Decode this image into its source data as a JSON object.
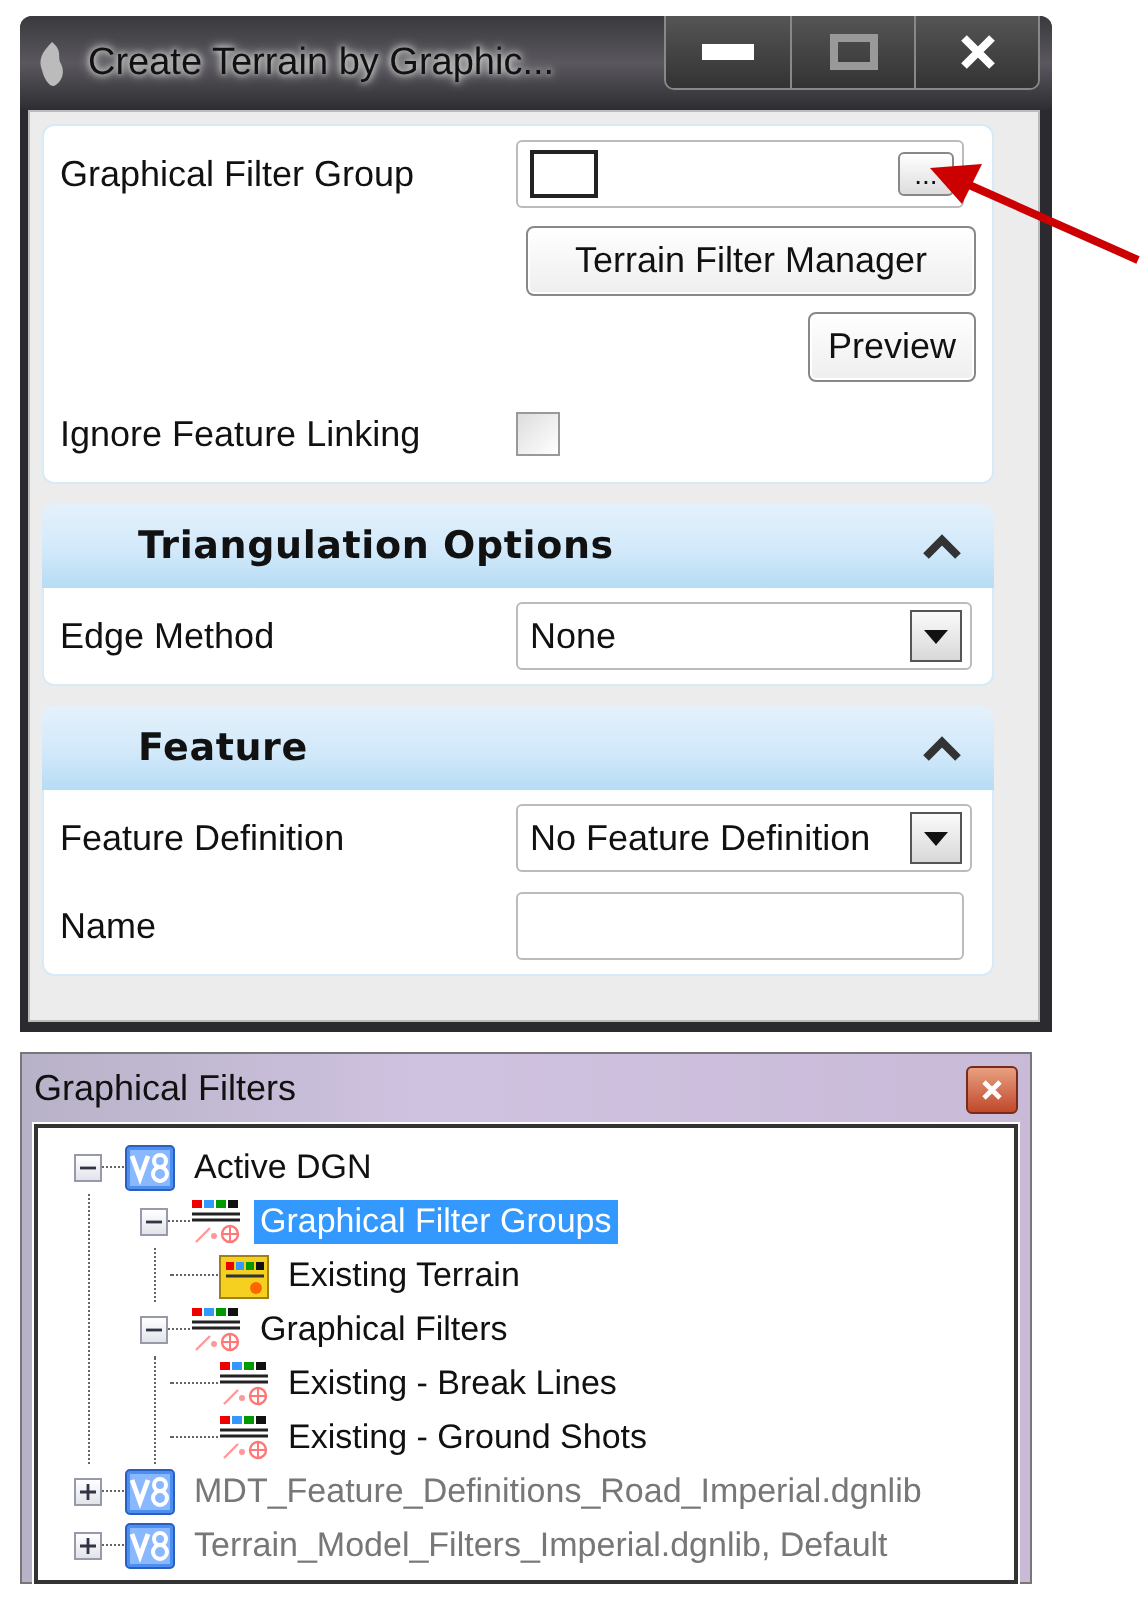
{
  "dialog": {
    "title": "Create Terrain by Graphic...",
    "filter_group": {
      "label": "Graphical Filter Group",
      "browse_label": "..."
    },
    "buttons": [
      {
        "label": "Terrain Filter Manager"
      },
      {
        "label": "Preview"
      }
    ],
    "ignore_feature_linking": {
      "label": "Ignore Feature Linking",
      "checked": false
    },
    "sections": [
      {
        "title": "Triangulation Options",
        "expanded": true,
        "rows": [
          {
            "kind": "combo",
            "label": "Edge Method",
            "value": "None"
          }
        ]
      },
      {
        "title": "Feature",
        "expanded": true,
        "rows": [
          {
            "kind": "combo",
            "label": "Feature Definition",
            "value": "No Feature Definition"
          },
          {
            "kind": "text",
            "label": "Name"
          }
        ]
      }
    ]
  },
  "filters_window": {
    "title": "Graphical Filters",
    "tree": [
      {
        "label": "Active DGN",
        "kind": "library",
        "expanded": true,
        "selected": false,
        "disabled": false,
        "children": [
          {
            "label": "Graphical Filter Groups",
            "kind": "filter-set",
            "expanded": true,
            "selected": true,
            "disabled": false,
            "children": [
              {
                "label": "Existing Terrain",
                "kind": "group",
                "selected": false,
                "disabled": false
              }
            ]
          },
          {
            "label": "Graphical Filters",
            "kind": "filter-set",
            "expanded": true,
            "selected": false,
            "disabled": false,
            "children": [
              {
                "label": "Existing - Break Lines",
                "kind": "filter",
                "selected": false,
                "disabled": false
              },
              {
                "label": "Existing - Ground Shots",
                "kind": "filter",
                "selected": false,
                "disabled": false
              }
            ]
          }
        ]
      },
      {
        "label": "MDT_Feature_Definitions_Road_Imperial.dgnlib",
        "kind": "library",
        "expanded": false,
        "selected": false,
        "disabled": true
      },
      {
        "label": "Terrain_Model_Filters_Imperial.dgnlib, Default",
        "kind": "library",
        "expanded": false,
        "selected": false,
        "disabled": true
      }
    ]
  }
}
